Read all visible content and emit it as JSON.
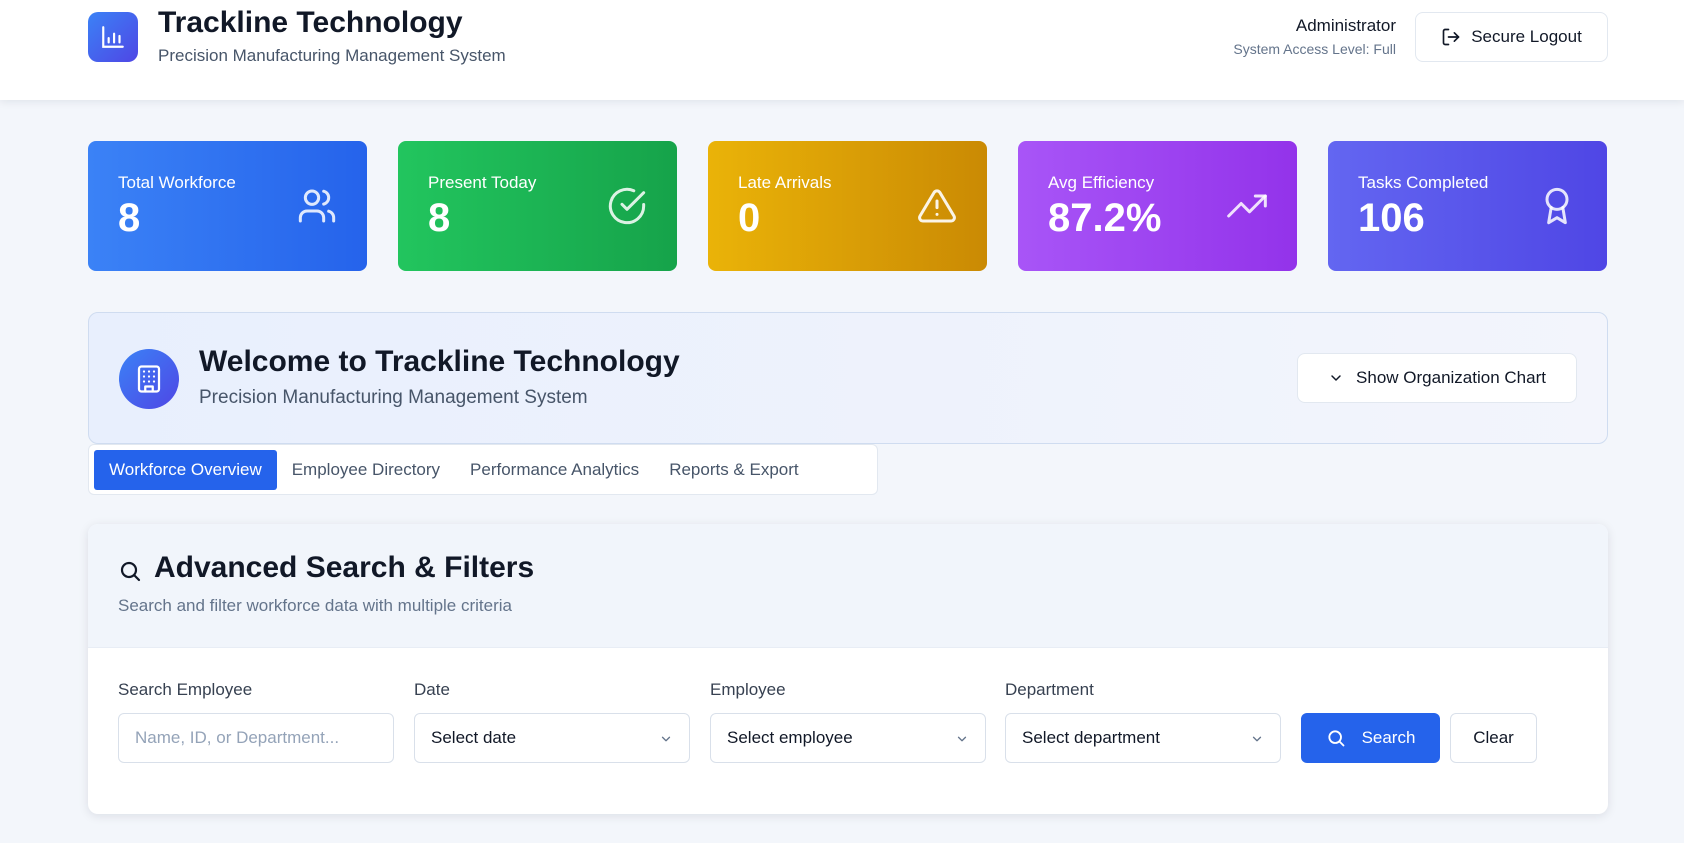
{
  "header": {
    "title": "Trackline Technology",
    "subtitle": "Precision Manufacturing Management System",
    "user_role": "Administrator",
    "user_access": "System Access Level: Full",
    "logout_label": "Secure Logout",
    "logo_icon": "bar-chart-icon"
  },
  "stats": [
    {
      "label": "Total Workforce",
      "value": "8",
      "icon": "users-icon",
      "color_from": "#3b82f6",
      "color_to": "#2563eb"
    },
    {
      "label": "Present Today",
      "value": "8",
      "icon": "check-circle-icon",
      "color_from": "#22c55e",
      "color_to": "#16a34a"
    },
    {
      "label": "Late Arrivals",
      "value": "0",
      "icon": "alert-triangle-icon",
      "color_from": "#eab308",
      "color_to": "#ca8a04"
    },
    {
      "label": "Avg Efficiency",
      "value": "87.2%",
      "icon": "trending-up-icon",
      "color_from": "#a855f7",
      "color_to": "#9333ea"
    },
    {
      "label": "Tasks Completed",
      "value": "106",
      "icon": "award-icon",
      "color_from": "#6366f1",
      "color_to": "#4f46e5"
    }
  ],
  "welcome": {
    "title": "Welcome to Trackline Technology",
    "subtitle": "Precision Manufacturing Management System",
    "org_chart_label": "Show Organization Chart",
    "icon": "building-icon"
  },
  "tabs": [
    {
      "label": "Workforce Overview",
      "active": true
    },
    {
      "label": "Employee Directory",
      "active": false
    },
    {
      "label": "Performance Analytics",
      "active": false
    },
    {
      "label": "Reports & Export",
      "active": false
    }
  ],
  "search": {
    "title": "Advanced Search & Filters",
    "description": "Search and filter workforce data with multiple criteria",
    "fields": {
      "employee_search": {
        "label": "Search Employee",
        "placeholder": "Name, ID, or Department..."
      },
      "date": {
        "label": "Date",
        "value": "Select date"
      },
      "employee": {
        "label": "Employee",
        "value": "Select employee"
      },
      "department": {
        "label": "Department",
        "value": "Select department"
      }
    },
    "search_label": "Search",
    "clear_label": "Clear"
  },
  "colors": {
    "accent": "#2563eb",
    "background": "#f3f6fb"
  }
}
